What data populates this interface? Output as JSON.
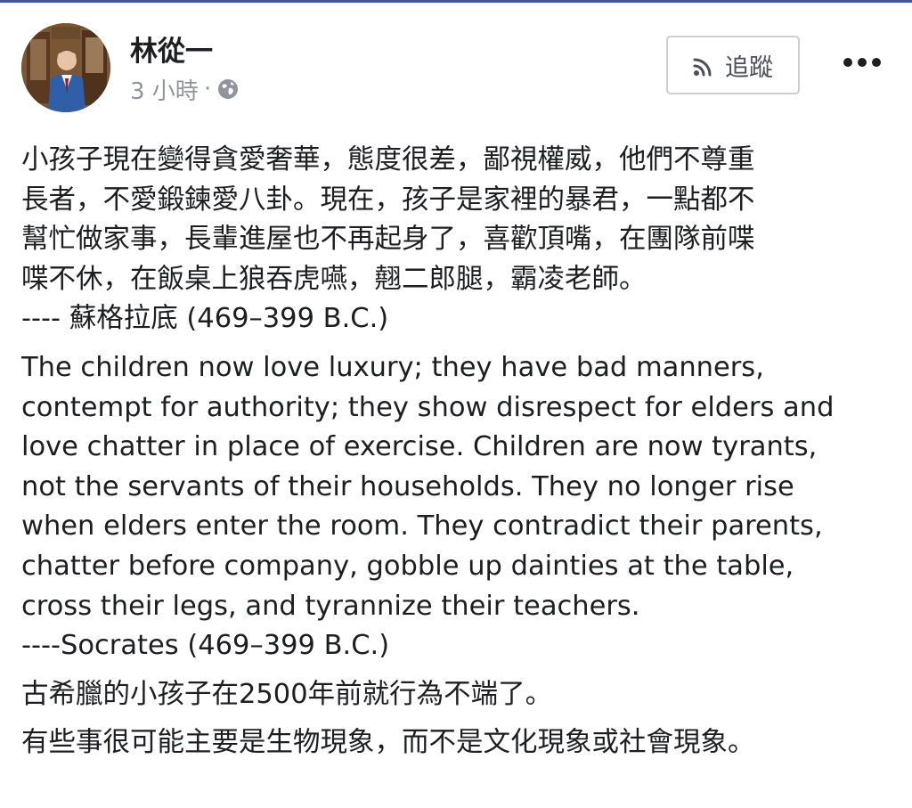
{
  "post": {
    "author": "林從一",
    "timestamp": "3 小時",
    "separator": "·",
    "privacy_icon": "globe-icon",
    "follow_label": "追蹤",
    "follow_icon": "rss-icon",
    "more_icon": "more-dots-icon",
    "body": {
      "chinese_quote": [
        "小孩子現在變得貪愛奢華，態度很差，鄙視權威，他們不尊重",
        "長者，不愛鍛鍊愛八卦。現在，孩子是家裡的暴君，一點都不",
        "幫忙做家事，長輩進屋也不再起身了，喜歡頂嘴，在團隊前喋",
        "喋不休，在飯桌上狼吞虎嚥，翹二郎腿，霸凌老師。",
        "---- 蘇格拉底 (469–399 B.C.)"
      ],
      "english_quote": [
        "The children now love luxury; they have bad manners,",
        "contempt for authority; they show disrespect for elders and",
        "love chatter in place of exercise. Children are now tyrants,",
        "not the servants of their households. They no longer rise",
        "when elders enter the room. They contradict their parents,",
        "chatter before company, gobble up dainties at the table,",
        "cross their legs, and tyrannize their teachers.",
        "----Socrates (469–399 B.C.)"
      ],
      "comment_1": "古希臘的小孩子在2500年前就行為不端了。",
      "comment_2": "有些事很可能主要是生物現象，而不是文化現象或社會現象。"
    }
  },
  "colors": {
    "top_rule": "#3b5998",
    "text": "#1c1e21",
    "meta": "#90949c",
    "button_border": "#ccd0d5",
    "button_text": "#4b4f56"
  }
}
